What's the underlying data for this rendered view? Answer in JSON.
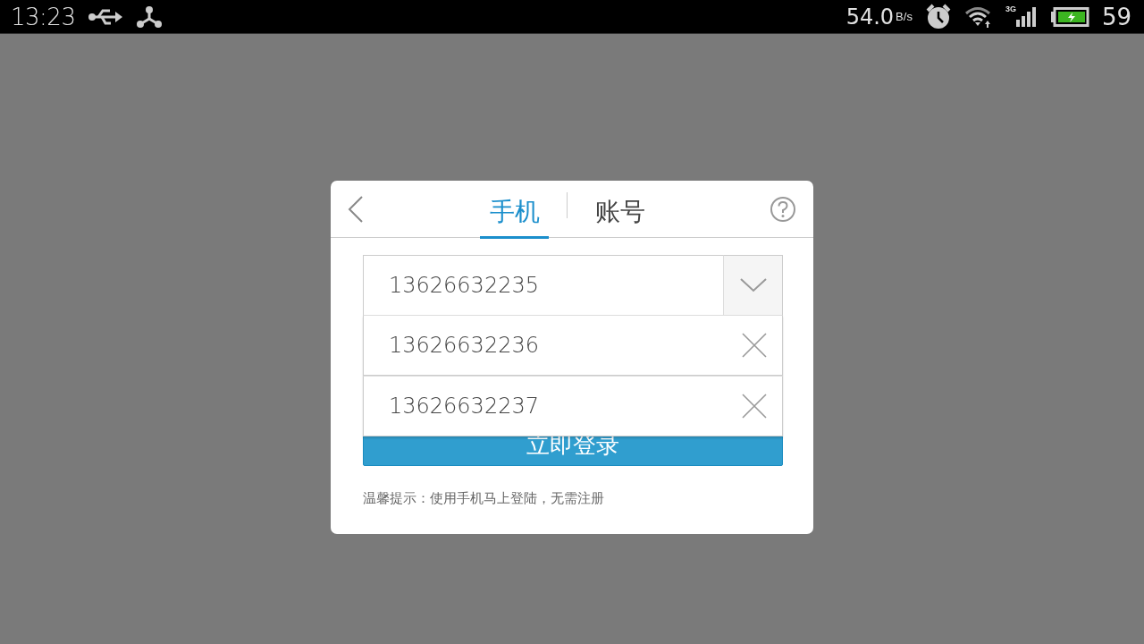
{
  "status_bar": {
    "time": "13:23",
    "net_speed": "54.0",
    "speed_unit": "B/s",
    "network_type": "3G",
    "battery": "59"
  },
  "dialog": {
    "tabs": [
      {
        "label": "手机",
        "selected": true
      },
      {
        "label": "账号",
        "selected": false
      }
    ],
    "phone_field": {
      "value": "13626632235",
      "dropdown_open": true
    },
    "history": [
      {
        "number": "13626632236"
      },
      {
        "number": "13626632237"
      }
    ],
    "login_button": "立即登录",
    "hint": "温馨提示：使用手机马上登陆，无需注册"
  }
}
